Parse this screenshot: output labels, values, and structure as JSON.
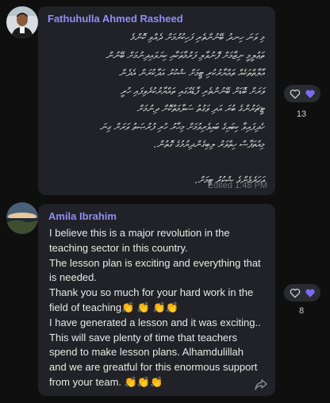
{
  "messages": [
    {
      "sender": "Fathuhulla Ahmed Rasheed",
      "body_rtl": "މި ވަނަ ހިނދު ބޭނުންތެރި ފަހިކުރުމަށް ދެއްވި ކޮންމެ\nތަޢުލީމީ ނިޒާމަށް ފޮނުވާލި ފަރުމާތަކާއި ކިޔަވައިދިނުމަށް ބޭނުން\nއާލާތްތަކެއް ތައްޔާރުކުރި ޓީމަށް ޝުކުރު އަދާކުރަން އެދެން\nވަރަށް ބޮޑަށް ބޭނުންތެރި ފާޑެއްގައި ތައްޔާރުކުރެވިފައި ހުރީ\nޓީޗަރުންގެ ބުރަ އަދި ވަގުތު ސަލާމަތްކޮށް ދިނުމަށް\nހެދިފައިވާ ކިބައިގެ ބައިވެރިވުމަށް މިހާރު ހުރި ފުރުޞަތު ވަރަށް ގިނަ\nމިއުތަފާސް ހިތްވަރު ލިބިގެންދިޔުމުގެ ގޮތުން.\n\nއަހަރެމެންގެ ޝުކުރު ޓީމަށް.",
      "edited_label": "Edited 1:48 PM",
      "reaction_count": "13"
    },
    {
      "sender": "Amila Ibrahim",
      "body_ltr": "I believe this is a major revolution in the\nteaching sector in this country.\nThe lesson plan is exciting and everything that\nis needed.\nThank you so much for your hard  work in the\nfield of teaching👏 👏 👏👏\nI have generated a lesson and it was exciting..\nThis will  save plenty of time that teachers\nspend to make lesson plans. Alhamdulillah\nand we are greatful for this enormous support\nfrom your  team. 👏👏👏",
      "reaction_count": "8"
    }
  ],
  "colors": {
    "background": "#0f0f10",
    "bubble": "#212227",
    "sender_name": "#8e8ff6",
    "heart_filled": "#7a6cf0"
  },
  "icons": [
    "heart-outline-icon",
    "heart-filled-icon",
    "forward-icon"
  ]
}
